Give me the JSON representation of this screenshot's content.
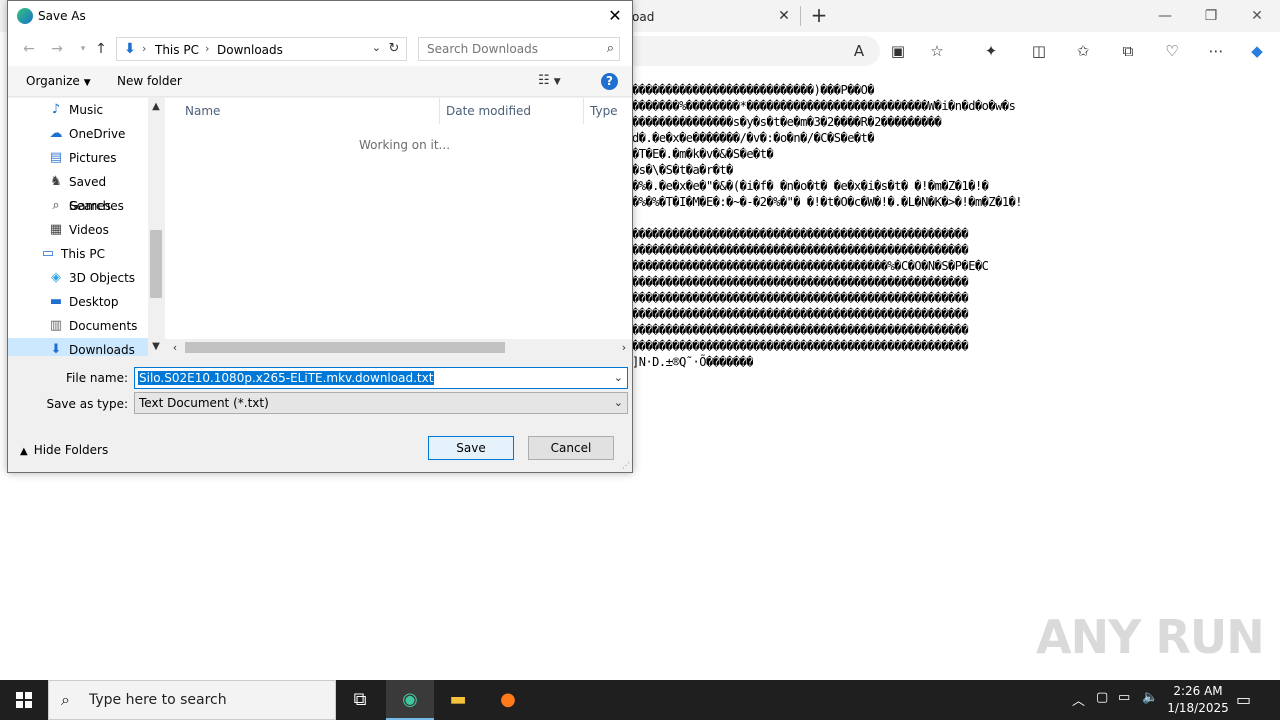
{
  "browser": {
    "tab_title": "oad",
    "content_lines": [
      "���������������������������)���P��O�",
      "�������%��������*���������������������������W�i�n�d�o�w�s",
      "���������������s�y�s�t�e�m�3�2����R�2���������",
      "d�.�e�x�e�������/�v�:�o�n�/�C�S�e�t�",
      "�T�E�.�m�k�v�&�S�e�t�",
      "�s�\\�S�t�a�r�t�",
      "�%�.�e�x�e�\"�&�(�i�f� �n�o�t� �e�x�i�s�t� �!�m�Z�1�!�",
      "�%�%�T�I�M�E�:�~�-�2�%�\"� �!�t�O�c�W�!�.�L�N�K�>�!�m�Z�1�!",
      "",
      "��������������������������������������������������",
      "��������������������������������������������������",
      "��������������������������������������%�C�O�N�S�P�E�C",
      "��������������������������������������������������",
      "��������������������������������������������������",
      "��������������������������������������������������",
      "��������������������������������������������������",
      "��������������������������������������������������",
      "]N·D.±®Q˜·Õ�������"
    ],
    "watermark": "ANY RUN"
  },
  "dialog": {
    "title": "Save As",
    "breadcrumb": [
      "This PC",
      "Downloads"
    ],
    "search_placeholder": "Search Downloads",
    "organize_label": "Organize",
    "new_folder_label": "New folder",
    "help_glyph": "?",
    "nav_items": [
      {
        "label": "Music",
        "icon": "music-icon",
        "indent": 1
      },
      {
        "label": "OneDrive",
        "icon": "cloud-icon",
        "indent": 1
      },
      {
        "label": "Pictures",
        "icon": "pictures-icon",
        "indent": 1
      },
      {
        "label": "Saved Games",
        "icon": "saved-games-icon",
        "indent": 1
      },
      {
        "label": "Searches",
        "icon": "searches-icon",
        "indent": 1
      },
      {
        "label": "Videos",
        "icon": "videos-icon",
        "indent": 1
      },
      {
        "label": "This PC",
        "icon": "computer-icon",
        "indent": 0
      },
      {
        "label": "3D Objects",
        "icon": "3d-objects-icon",
        "indent": 1
      },
      {
        "label": "Desktop",
        "icon": "desktop-icon",
        "indent": 1
      },
      {
        "label": "Documents",
        "icon": "documents-icon",
        "indent": 1
      },
      {
        "label": "Downloads",
        "icon": "downloads-icon",
        "indent": 1,
        "selected": true
      }
    ],
    "columns": [
      "Name",
      "Date modified",
      "Type"
    ],
    "status_text": "Working on it...",
    "file_name_label": "File name:",
    "file_name_value": "Silo.S02E10.1080p.x265-ELiTE.mkv.download.txt",
    "save_type_label": "Save as type:",
    "save_type_value": "Text Document (*.txt)",
    "hide_folders_label": "Hide Folders",
    "save_label": "Save",
    "cancel_label": "Cancel"
  },
  "taskbar": {
    "search_placeholder": "Type here to search",
    "time": "2:26 AM",
    "date": "1/18/2025"
  }
}
